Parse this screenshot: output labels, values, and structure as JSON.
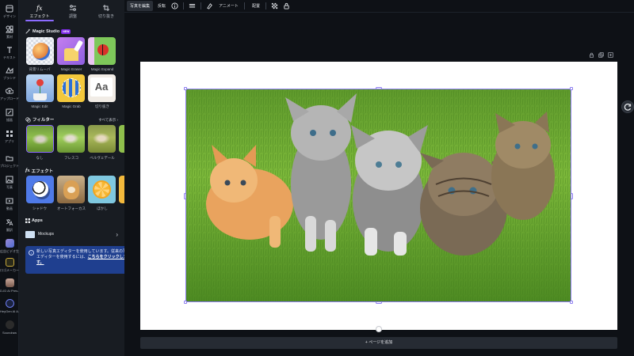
{
  "rail": {
    "items": [
      {
        "label": "デザイン",
        "icon": "design-icon"
      },
      {
        "label": "素材",
        "icon": "elements-icon"
      },
      {
        "label": "テキスト",
        "icon": "text-icon"
      },
      {
        "label": "ブランド",
        "icon": "brand-icon"
      },
      {
        "label": "アップロード",
        "icon": "upload-icon"
      },
      {
        "label": "描画",
        "icon": "draw-icon"
      },
      {
        "label": "アプリ",
        "icon": "apps-icon"
      },
      {
        "label": "プロジェクト",
        "icon": "projects-icon"
      },
      {
        "label": "写真",
        "icon": "photos-icon"
      },
      {
        "label": "動画",
        "icon": "videos-icon"
      },
      {
        "label": "翻訳",
        "icon": "translate-icon"
      },
      {
        "label": "広告ビデオ生...",
        "icon": "ad-video-app-icon"
      },
      {
        "label": "ロゴメーカー",
        "icon": "logo-maker-app-icon"
      },
      {
        "label": "D-ID AI Pres...",
        "icon": "did-app-icon"
      },
      {
        "label": "HeyGen AI A...",
        "icon": "heygen-app-icon"
      },
      {
        "label": "Soundraw",
        "icon": "soundraw-app-icon"
      }
    ]
  },
  "panel": {
    "tabs": [
      {
        "label": "エフェクト",
        "icon": "fx-icon"
      },
      {
        "label": "調整",
        "icon": "sliders-icon"
      },
      {
        "label": "切り抜き",
        "icon": "crop-icon"
      }
    ],
    "magic_studio": {
      "title": "Magic Studio",
      "badge": "NEW",
      "tools": [
        {
          "label": "背景リムーバ"
        },
        {
          "label": "Magic Eraser"
        },
        {
          "label": "Magic Expand"
        },
        {
          "label": "Magic Edit"
        },
        {
          "label": "Magic Grab"
        },
        {
          "label": "切り抜き"
        }
      ]
    },
    "filters": {
      "title": "フィルター",
      "see_all": "すべて表示",
      "items": [
        {
          "label": "なし"
        },
        {
          "label": "フレスコ"
        },
        {
          "label": "ベルヴェデール"
        }
      ]
    },
    "effects": {
      "title": "エフェクト",
      "items": [
        {
          "label": "シャドウ"
        },
        {
          "label": "オートフォーカス"
        },
        {
          "label": "ぼかし"
        }
      ]
    },
    "apps": {
      "title": "Apps",
      "item_label": "Mockups"
    },
    "notice": {
      "text": "新しい写真エディターを使用しています。従来の写真エディターを使用するには、",
      "link": "こちらをクリックします。"
    }
  },
  "toolbar": {
    "edit_photo": "写真を編集",
    "flip": "反転",
    "animate": "アニメート",
    "position": "配置"
  },
  "canvas": {
    "add_page": "+ ページを追加"
  },
  "colors": {
    "accent": "#8b6bff",
    "notice_bg": "#1f3f8f",
    "selection": "#8c7cf0"
  }
}
